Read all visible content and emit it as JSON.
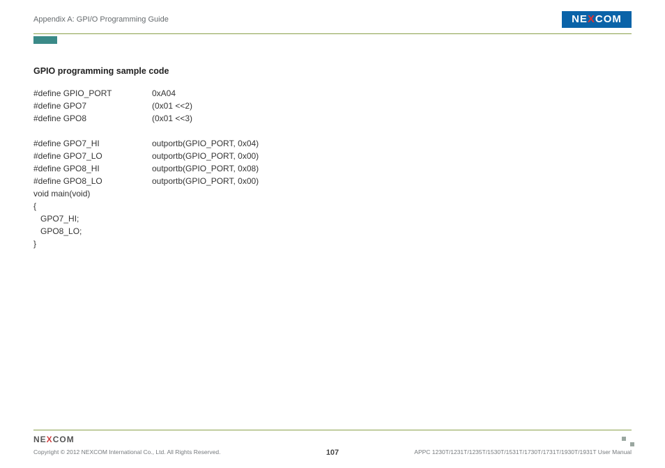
{
  "header": {
    "title": "Appendix A: GPI/O Programming Guide",
    "logo_pre": "NE",
    "logo_x": "X",
    "logo_post": "COM"
  },
  "content": {
    "section_title": "GPIO programming sample code",
    "rows": [
      {
        "c1": "#define GPIO_PORT",
        "c2": "0xA04"
      },
      {
        "c1": "#define GPO7",
        "c2": "(0x01 <<2)"
      },
      {
        "c1": "#define GPO8",
        "c2": "(0x01 <<3)"
      }
    ],
    "rows2": [
      {
        "c1": "#define GPO7_HI",
        "c2": "outportb(GPIO_PORT, 0x04)"
      },
      {
        "c1": "#define GPO7_LO",
        "c2": "outportb(GPIO_PORT, 0x00)"
      },
      {
        "c1": "#define GPO8_HI",
        "c2": "outportb(GPIO_PORT, 0x08)"
      },
      {
        "c1": "#define GPO8_LO",
        "c2": "outportb(GPIO_PORT, 0x00)"
      }
    ],
    "tail": {
      "l1": "void main(void)",
      "l2": "{",
      "l3": "   GPO7_HI;",
      "l4": "   GPO8_LO;",
      "l5": "}"
    }
  },
  "footer": {
    "logo_pre": "NE",
    "logo_x": "X",
    "logo_post": "COM",
    "copyright": "Copyright © 2012 NEXCOM International Co., Ltd. All Rights Reserved.",
    "page": "107",
    "manual": "APPC 1230T/1231T/1235T/1530T/1531T/1730T/1731T/1930T/1931T User Manual"
  }
}
